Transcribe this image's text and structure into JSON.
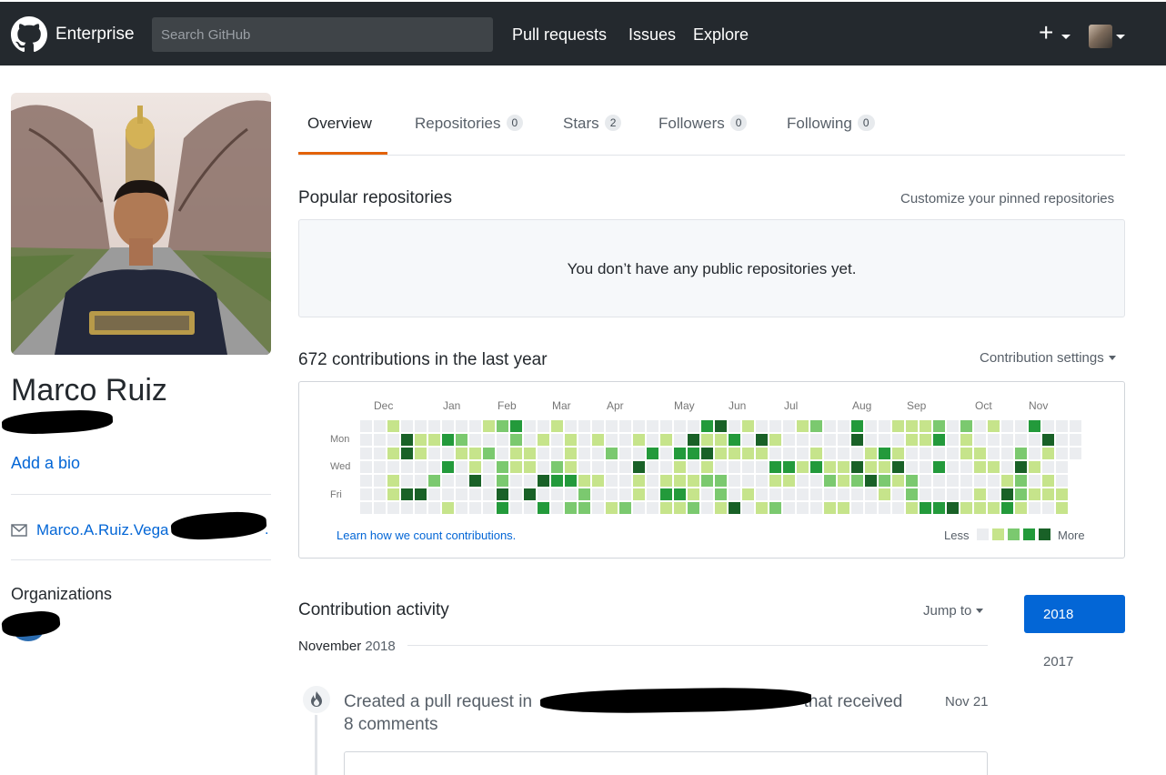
{
  "header": {
    "brand": "Enterprise",
    "search_placeholder": "Search GitHub",
    "nav": [
      "Pull requests",
      "Issues",
      "Explore"
    ],
    "new_label": "+"
  },
  "profile": {
    "name": "Marco Ruiz",
    "add_bio": "Add a bio",
    "email": "Marco.A.Ruiz.Vega",
    "organizations_title": "Organizations"
  },
  "tabs": [
    {
      "label": "Overview",
      "count": null
    },
    {
      "label": "Repositories",
      "count": "0"
    },
    {
      "label": "Stars",
      "count": "2"
    },
    {
      "label": "Followers",
      "count": "0"
    },
    {
      "label": "Following",
      "count": "0"
    }
  ],
  "popular": {
    "title": "Popular repositories",
    "customize": "Customize your pinned repositories",
    "empty_text": "You don’t have any public repositories yet."
  },
  "contributions": {
    "title": "672 contributions in the last year",
    "settings": "Contribution settings",
    "months": [
      "Dec",
      "Jan",
      "Feb",
      "Mar",
      "Apr",
      "May",
      "Jun",
      "Jul",
      "Aug",
      "Sep",
      "Oct",
      "Nov"
    ],
    "day_labels": [
      "Mon",
      "Wed",
      "Fri"
    ],
    "learn": "Learn how we count contributions.",
    "less": "Less",
    "more": "More",
    "colors": [
      "#ebedf0",
      "#c6e48b",
      "#7bc96f",
      "#239a3b",
      "#196127"
    ]
  },
  "activity": {
    "title": "Contribution activity",
    "jump": "Jump to",
    "years": [
      "2018",
      "2017"
    ],
    "month_label": "November",
    "month_year": "2018",
    "event_prefix": "Created a pull request in",
    "event_suffix": "that received",
    "event_comments": "8 comments",
    "event_date": "Nov 21"
  }
}
